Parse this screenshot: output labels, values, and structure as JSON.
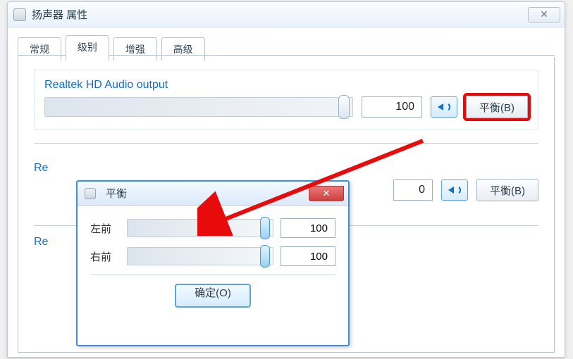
{
  "window": {
    "title": "扬声器 属性",
    "close_glyph": "✕"
  },
  "tabs": {
    "general": "常规",
    "levels": "级别",
    "enhance": "增强",
    "advanced": "高级",
    "active": "levels"
  },
  "main_output": {
    "label": "Realtek HD Audio output",
    "value": "100",
    "balance_btn": "平衡(B)"
  },
  "second_output": {
    "label_prefix": "Re",
    "value": "0",
    "balance_btn": "平衡(B)"
  },
  "third_output": {
    "label_prefix": "Re"
  },
  "balance_dialog": {
    "title": "平衡",
    "close_glyph": "✕",
    "left_label": "左前",
    "left_value": "100",
    "right_label": "右前",
    "right_value": "100",
    "ok_btn": "确定(O)"
  }
}
